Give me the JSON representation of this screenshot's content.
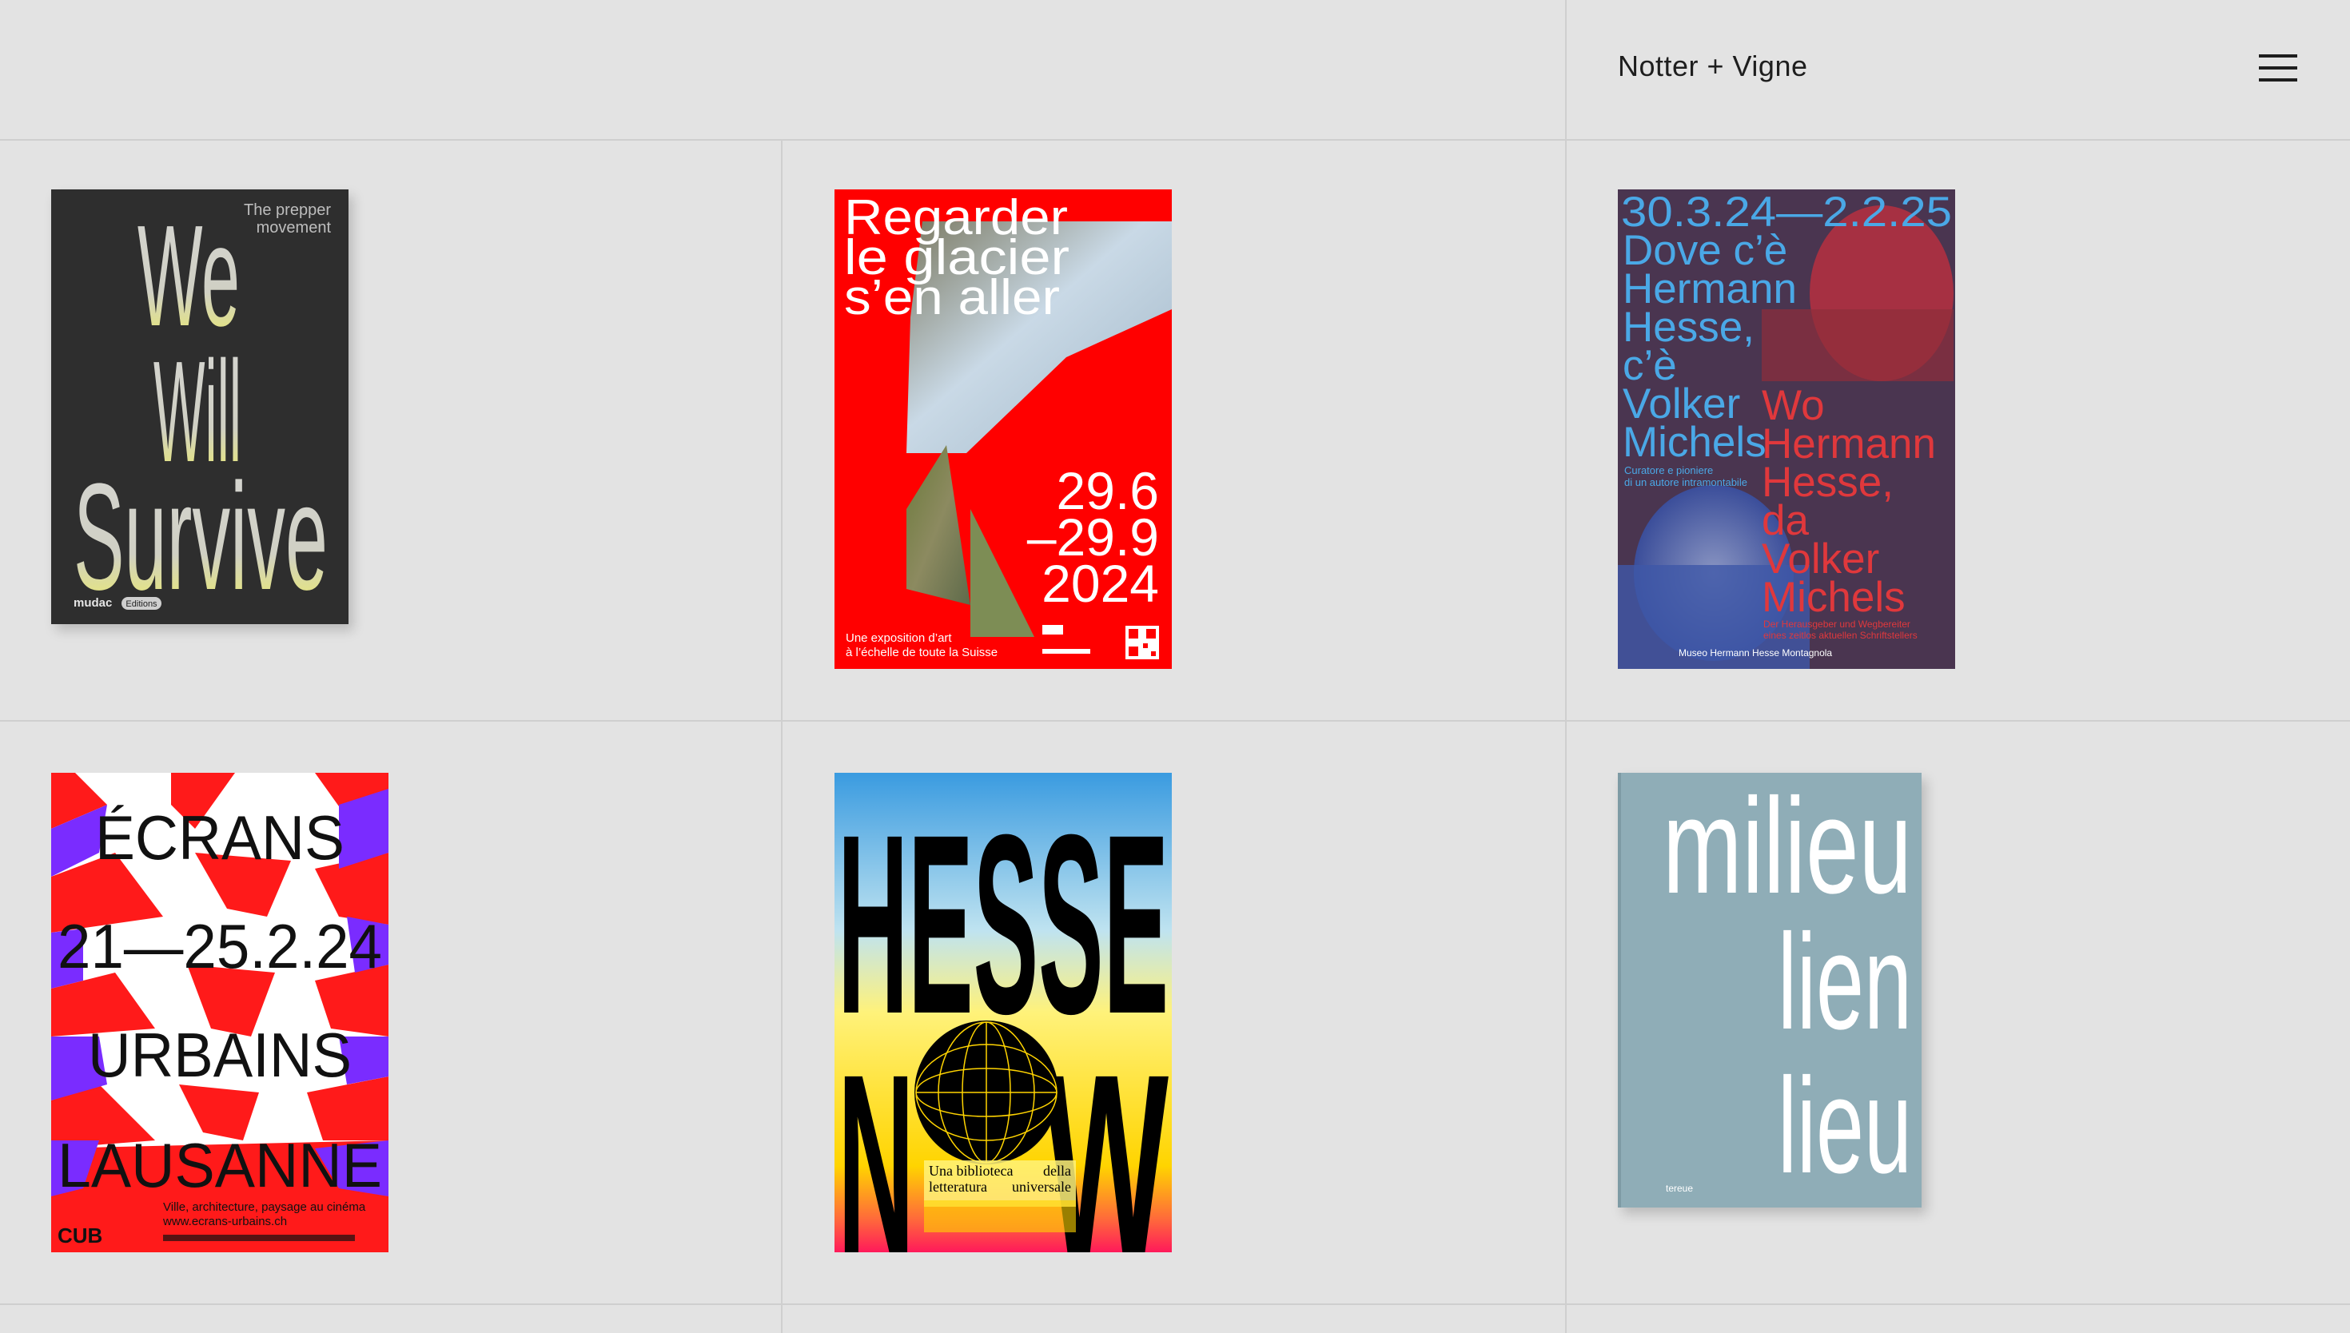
{
  "header": {
    "brand": "Notter + Vigne",
    "menu_icon": "hamburger-menu-icon"
  },
  "posters": [
    {
      "id": "we-will-survive",
      "title_lines": [
        "We",
        "Will",
        "Survive"
      ],
      "subtitle_lines": [
        "The prepper",
        "movement"
      ],
      "publisher": "mudac",
      "badge": "Editions"
    },
    {
      "id": "regarder-le-glacier",
      "title_lines": [
        "Regarder",
        "le glacier",
        "s’en aller"
      ],
      "dates": [
        "29.6",
        "–29.9",
        "2024"
      ],
      "caption_lines": [
        "Une exposition d’art",
        "à l’échelle de toute la Suisse"
      ]
    },
    {
      "id": "hermann-hesse-volker-michels",
      "dates": "30.3.24—2.2.25",
      "title_it": [
        "Dove c’è",
        "Hermann",
        "Hesse,",
        "c’è",
        "Volker",
        "Michels"
      ],
      "subtitle_it": [
        "Curatore e pioniere",
        "di un autore intramontabile"
      ],
      "title_de": [
        "Wo",
        "Hermann",
        "Hesse,",
        "da",
        "Volker",
        "Michels"
      ],
      "subtitle_de": [
        "Der Herausgeber und Wegbereiter",
        "eines zeitlos aktuellen Schriftstellers"
      ],
      "footer": "Museo Hermann Hesse Montagnola"
    },
    {
      "id": "ecrans-urbains",
      "line1": "ÉCRANS",
      "dates": "21—25.2.24",
      "line2": "URBAINS",
      "city": "LAUSANNE",
      "caption_lines": [
        "Ville, architecture, paysage au cinéma",
        "www.ecrans-urbains.ch"
      ],
      "logo": "CUB"
    },
    {
      "id": "hesse-now",
      "line1": "HESSE",
      "line2_parts": [
        "N",
        "W"
      ],
      "caption_top": [
        "Una biblioteca",
        "della"
      ],
      "caption_bottom": [
        "letteratura",
        "universale"
      ]
    },
    {
      "id": "milieu-lien-lieu",
      "title_lines": [
        "milieu",
        "lien",
        "lieu"
      ],
      "publisher": "tereue"
    }
  ],
  "colors": {
    "background": "#e3e3e3",
    "grid_line": "#cfcfcf",
    "poster_red": "#ff0000",
    "hesse_blue": "#4aa8e6",
    "hesse_bg": "#4a3550",
    "ecrans_purple": "#7a2cff",
    "book_blue": "#8fadb7"
  }
}
